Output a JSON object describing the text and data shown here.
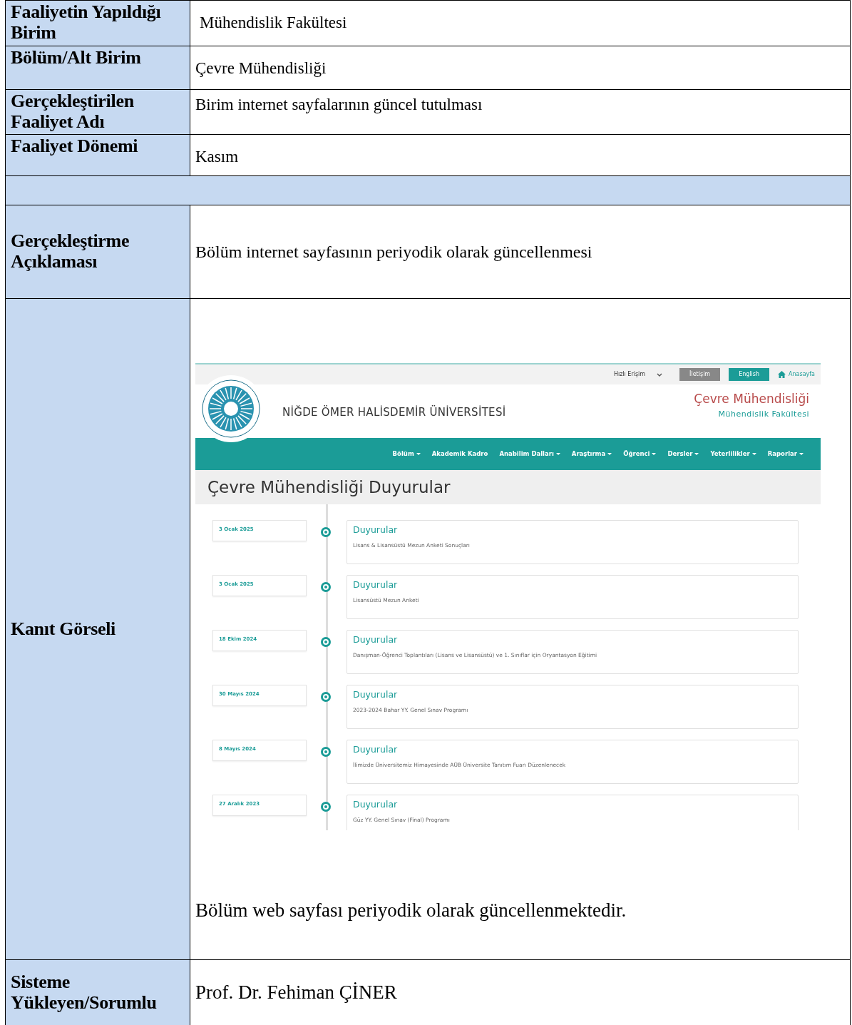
{
  "form": {
    "rows": [
      {
        "kind": "text",
        "label": "Faaliyetin Yapıldığı Birim",
        "value": "Mühendislik Fakültesi"
      },
      {
        "kind": "text",
        "label": "Bölüm/Alt Birim",
        "value": "Çevre Mühendisliği"
      },
      {
        "kind": "text",
        "label": "Gerçekleştirilen Faaliyet Adı",
        "value": "Birim internet sayfalarının güncel tutulması"
      },
      {
        "kind": "text",
        "label": "Faaliyet Dönemi",
        "value": "Kasım"
      },
      {
        "kind": "spacer"
      },
      {
        "kind": "text",
        "label": "Gerçekleştirme Açıklaması",
        "value": "Bölüm internet sayfasının periyodik olarak güncellenmesi"
      },
      {
        "kind": "evidence",
        "label": "Kanıt Görseli",
        "value": "Bölüm web sayfası periyodik olarak güncellenmektedir.",
        "screenshot": {
          "top_bar": {
            "quick_access": "Hızlı Erişim",
            "contact": "İletişim",
            "language": "English",
            "home": "Anasayfa"
          },
          "university": "NİĞDE ÖMER HALİSDEMİR ÜNİVERSİTESİ",
          "department": "Çevre Mühendisliği",
          "faculty": "Mühendislik Fakültesi",
          "nav": [
            {
              "label": "Bölüm",
              "dropdown": true
            },
            {
              "label": "Akademik Kadro",
              "dropdown": false
            },
            {
              "label": "Anabilim Dalları",
              "dropdown": true
            },
            {
              "label": "Araştırma",
              "dropdown": true
            },
            {
              "label": "Öğrenci",
              "dropdown": true
            },
            {
              "label": "Dersler",
              "dropdown": true
            },
            {
              "label": "Yeterlilikler",
              "dropdown": true
            },
            {
              "label": "Raporlar",
              "dropdown": true
            }
          ],
          "page_title": "Çevre Mühendisliği Duyurular",
          "announcements": [
            {
              "date": "3 Ocak 2025",
              "category": "Duyurular",
              "title": "Lisans & Lisansüstü Mezun Anketi Sonuçları"
            },
            {
              "date": "3 Ocak 2025",
              "category": "Duyurular",
              "title": "Lisansüstü Mezun Anketi"
            },
            {
              "date": "18 Ekim 2024",
              "category": "Duyurular",
              "title": "Danışman-Öğrenci Toplantıları (Lisans ve Lisansüstü) ve 1. Sınıflar için Oryantasyon Eğitimi"
            },
            {
              "date": "30 Mayıs 2024",
              "category": "Duyurular",
              "title": "2023-2024 Bahar YY. Genel Sınav Programı"
            },
            {
              "date": "8 Mayıs 2024",
              "category": "Duyurular",
              "title": "İlimizde Üniversitemiz Himayesinde AÜB Üniversite Tanıtım Fuarı Düzenlenecek"
            },
            {
              "date": "27 Aralık 2023",
              "category": "Duyurular",
              "title": "Güz YY. Genel Sınav (Final) Programı"
            }
          ]
        }
      },
      {
        "kind": "text",
        "label": "Sisteme Yükleyen/Sorumlu",
        "value": "Prof. Dr. Fehiman ÇİNER"
      }
    ]
  }
}
